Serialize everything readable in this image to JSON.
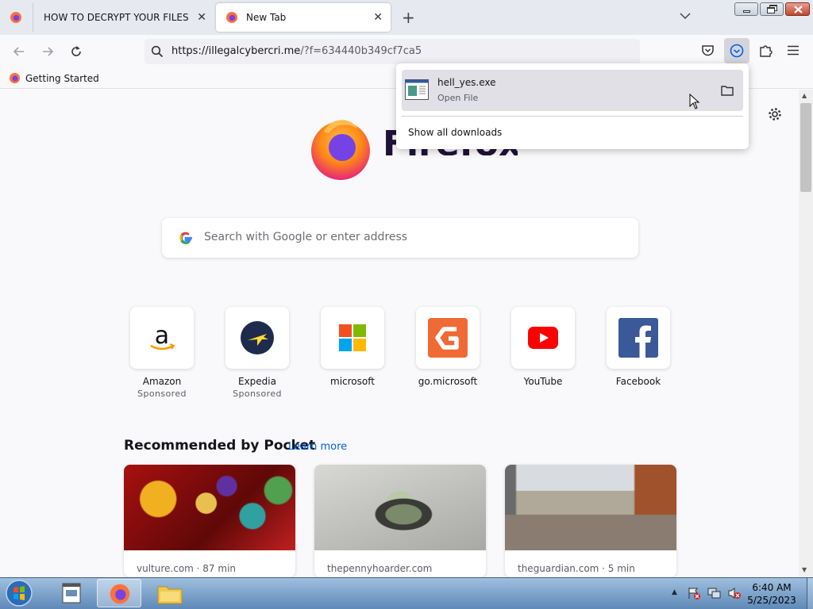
{
  "browser": {
    "tabs": [
      {
        "label": ""
      },
      {
        "label": "HOW TO DECRYPT YOUR FILES"
      },
      {
        "label": "New Tab"
      }
    ],
    "url": {
      "domain": "https://illegalcybercri.me",
      "path": "/?f=634440b349cf7ca5"
    },
    "bookmarks": [
      {
        "label": "Getting Started"
      }
    ]
  },
  "downloads": {
    "file_name": "hell_yes.exe",
    "file_status": "Open File",
    "show_all": "Show all downloads"
  },
  "newtab": {
    "logo_text": "Firefox",
    "search_placeholder": "Search with Google or enter address",
    "shortcuts": [
      {
        "name": "Amazon",
        "sponsored": "Sponsored",
        "icon": "amazon-icon"
      },
      {
        "name": "Expedia",
        "sponsored": "Sponsored",
        "icon": "expedia-icon"
      },
      {
        "name": "microsoft",
        "sponsored": "",
        "icon": "microsoft-icon"
      },
      {
        "name": "go.microsoft",
        "sponsored": "",
        "icon": "go-microsoft-icon"
      },
      {
        "name": "YouTube",
        "sponsored": "",
        "icon": "youtube-icon"
      },
      {
        "name": "Facebook",
        "sponsored": "",
        "icon": "facebook-icon"
      }
    ],
    "pocket": {
      "heading": "Recommended by Pocket",
      "learn_more": "Learn more",
      "cards": [
        {
          "source": "vulture.com · 87 min"
        },
        {
          "source": "thepennyhoarder.com"
        },
        {
          "source": "theguardian.com · 5 min"
        }
      ]
    }
  },
  "taskbar": {
    "time": "6:40 AM",
    "date": "5/25/2023"
  },
  "colors": {
    "accent": "#0061e0",
    "youtube": "#ff0000",
    "facebook": "#3b5998"
  }
}
